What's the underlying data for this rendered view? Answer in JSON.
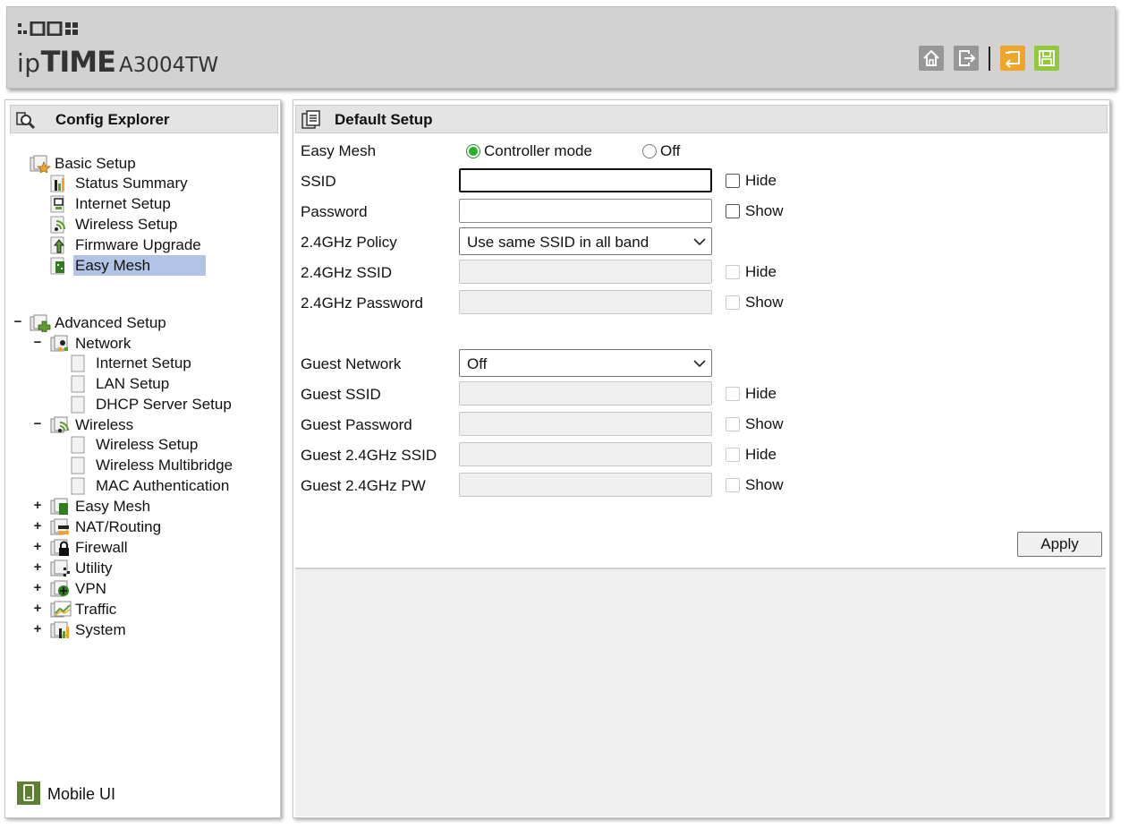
{
  "header": {
    "brand_ip": "ip",
    "brand_time": "TIME",
    "model": "A3004TW",
    "buttons": {
      "home": "home-icon",
      "logout": "logout-icon",
      "restore": "restore-icon",
      "save": "save-icon"
    },
    "colors": {
      "header_bg": "#d2d2d2",
      "restore": "#f0a52a",
      "save": "#92c83e"
    }
  },
  "sidebar": {
    "title": "Config Explorer",
    "basic": {
      "label": "Basic Setup",
      "items": [
        "Status Summary",
        "Internet Setup",
        "Wireless Setup",
        "Firmware Upgrade",
        "Easy Mesh"
      ],
      "selected": "Easy Mesh"
    },
    "advanced": {
      "label": "Advanced Setup",
      "toggle": "−",
      "network": {
        "label": "Network",
        "toggle": "−",
        "items": [
          "Internet Setup",
          "LAN Setup",
          "DHCP Server Setup"
        ]
      },
      "wireless": {
        "label": "Wireless",
        "toggle": "−",
        "items": [
          "Wireless Setup",
          "Wireless Multibridge",
          "MAC Authentication"
        ]
      },
      "collapsed": [
        {
          "label": "Easy Mesh",
          "toggle": "+"
        },
        {
          "label": "NAT/Routing",
          "toggle": "+"
        },
        {
          "label": "Firewall",
          "toggle": "+"
        },
        {
          "label": "Utility",
          "toggle": "+"
        },
        {
          "label": "VPN",
          "toggle": "+"
        },
        {
          "label": "Traffic",
          "toggle": "+"
        },
        {
          "label": "System",
          "toggle": "+"
        }
      ]
    },
    "mobile_ui": "Mobile UI",
    "selection_color": "#b1c4e5"
  },
  "main": {
    "title": "Default Setup",
    "easy_mesh": {
      "label": "Easy Mesh",
      "options": [
        "Controller mode",
        "Off"
      ],
      "selected": "Controller mode"
    },
    "ssid": {
      "label": "SSID",
      "value": "",
      "check_label": "Hide",
      "checked": false
    },
    "password": {
      "label": "Password",
      "value": "",
      "check_label": "Show",
      "checked": false
    },
    "policy": {
      "label": "2.4GHz Policy",
      "value": "Use same SSID in all band"
    },
    "ssid_24": {
      "label": "2.4GHz SSID",
      "check_label": "Hide",
      "disabled": true
    },
    "password_24": {
      "label": "2.4GHz Password",
      "check_label": "Show",
      "disabled": true
    },
    "guest_network": {
      "label": "Guest Network",
      "value": "Off"
    },
    "guest_ssid": {
      "label": "Guest SSID",
      "check_label": "Hide",
      "disabled": true
    },
    "guest_password": {
      "label": "Guest Password",
      "check_label": "Show",
      "disabled": true
    },
    "guest_ssid_24": {
      "label": "Guest 2.4GHz SSID",
      "check_label": "Hide",
      "disabled": true
    },
    "guest_pw_24": {
      "label": "Guest 2.4GHz PW",
      "check_label": "Show",
      "disabled": true
    },
    "apply": "Apply",
    "colors": {
      "radio_checked": "#22b422",
      "disabled_field": "#efefef"
    }
  }
}
